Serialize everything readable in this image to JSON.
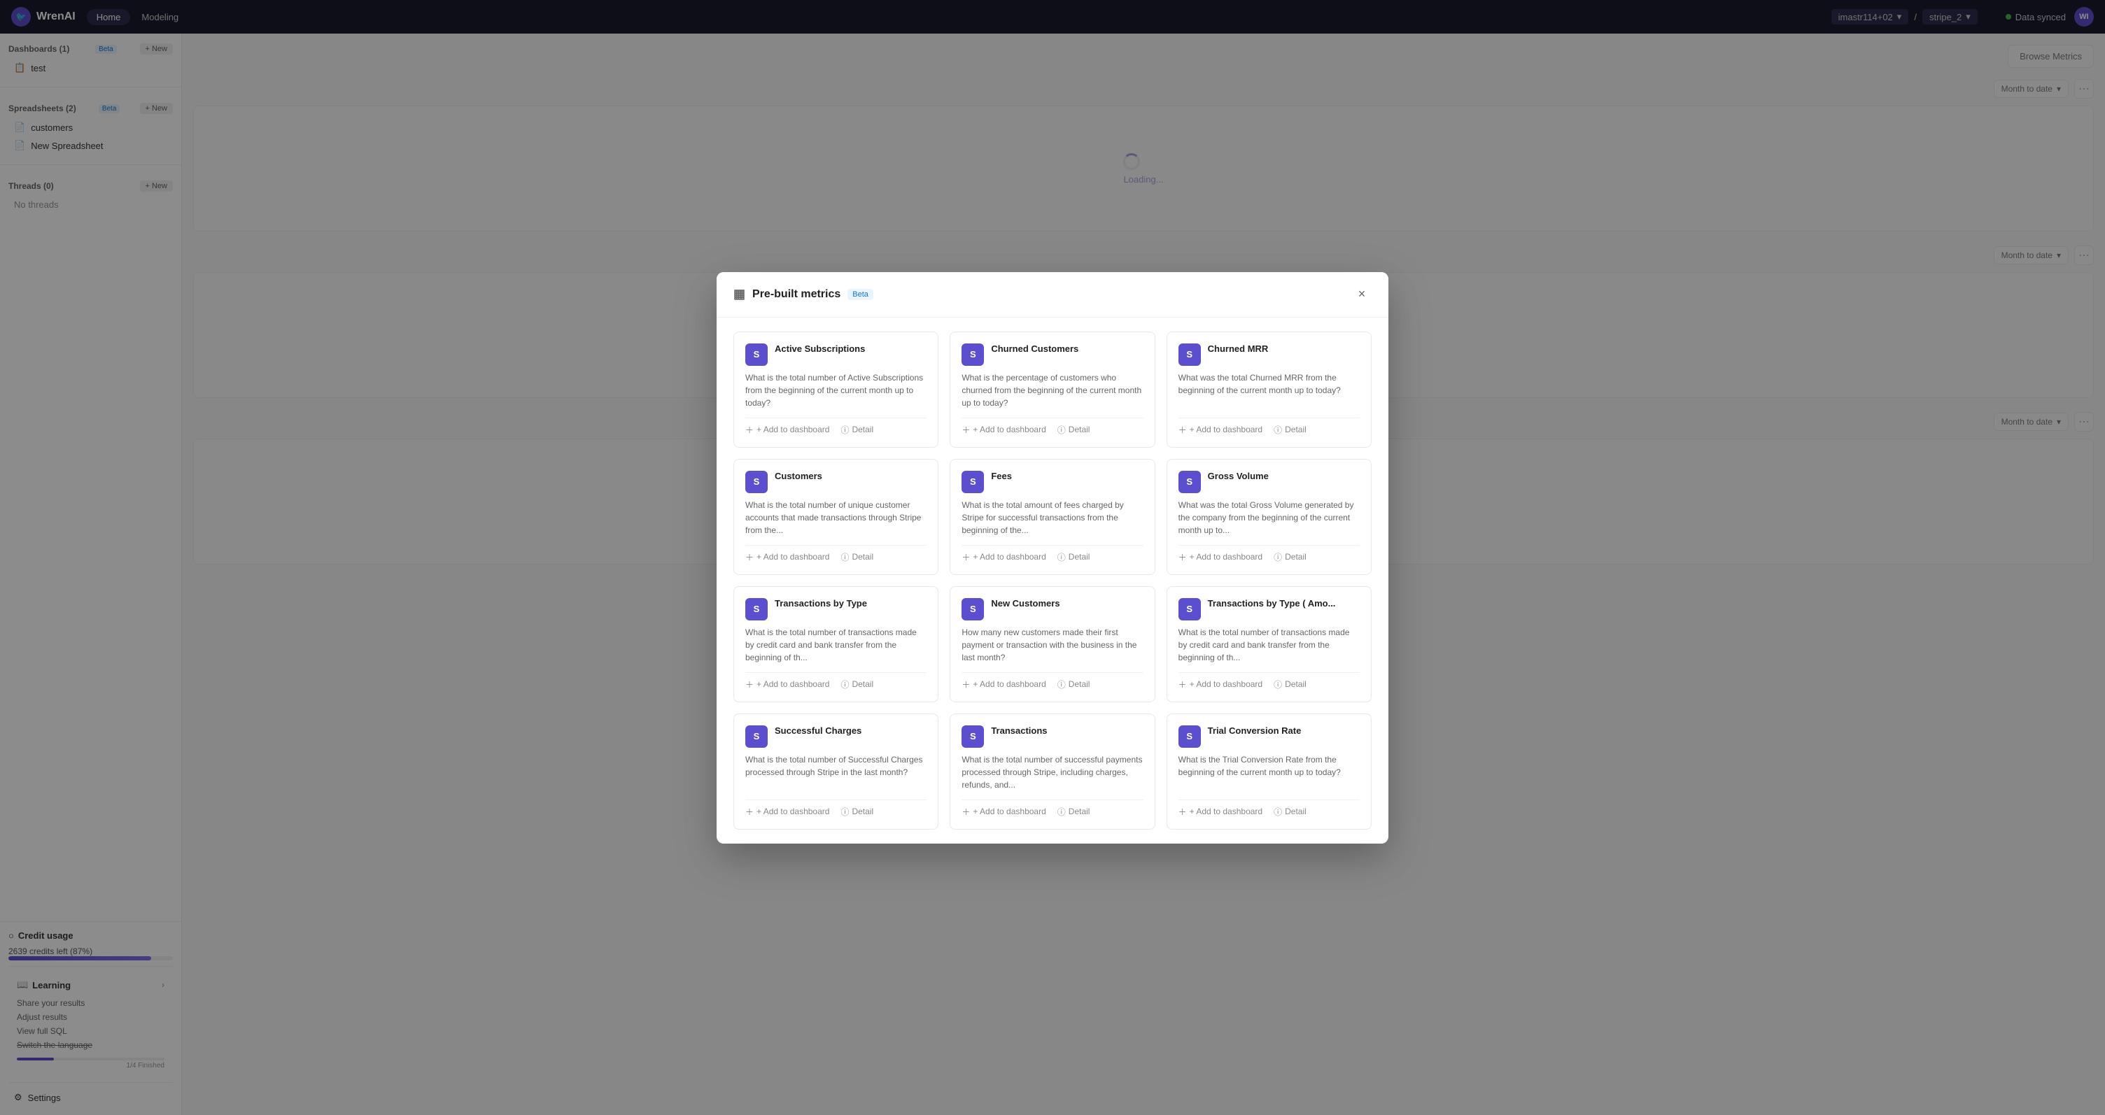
{
  "app": {
    "name": "WrenAI",
    "logo_text": "W"
  },
  "topnav": {
    "home_label": "Home",
    "modeling_label": "Modeling",
    "project": "imastr114+02",
    "project_chevron": "▾",
    "separator": "/",
    "database": "stripe_2",
    "database_chevron": "▾",
    "sync_label": "Data synced",
    "avatar_initials": "WI"
  },
  "sidebar": {
    "dashboards_label": "Dashboards (1)",
    "dashboards_beta": "Beta",
    "dashboards_new": "+ New",
    "dashboard_items": [
      {
        "name": "test",
        "icon": "📋"
      }
    ],
    "spreadsheets_label": "Spreadsheets (2)",
    "spreadsheets_beta": "Beta",
    "spreadsheets_new": "+ New",
    "spreadsheet_items": [
      {
        "name": "customers"
      },
      {
        "name": "New Spreadsheet"
      }
    ],
    "threads_label": "Threads (0)",
    "threads_new": "+ New",
    "threads_empty": "No threads",
    "credit_usage_label": "Credit usage",
    "credit_icon": "○",
    "credit_value": "2639 credits left (87%)",
    "credit_percent": 87,
    "learning_label": "Learning",
    "learning_icon": "📖",
    "learning_items": [
      {
        "label": "Share your results"
      },
      {
        "label": "Adjust results"
      },
      {
        "label": "View full SQL"
      },
      {
        "label": "Switch the language"
      }
    ],
    "progress_label": "1/4 Finished",
    "settings_label": "Settings"
  },
  "main": {
    "browse_btn": "Browse Metrics",
    "sections": [
      {
        "id": "section1",
        "date_filter": "Month to date"
      },
      {
        "id": "section2",
        "date_filter": "Month to date"
      },
      {
        "id": "section3",
        "date_filter": "Month to date"
      }
    ]
  },
  "modal": {
    "title": "Pre-built metrics",
    "beta": "Beta",
    "close_label": "×",
    "metrics": [
      {
        "id": "active-subscriptions",
        "icon": "S",
        "name": "Active Subscriptions",
        "desc": "What is the total number of Active Subscriptions from the beginning of the current month up to today?",
        "add_label": "+ Add to dashboard",
        "detail_label": "Detail"
      },
      {
        "id": "churned-customers",
        "icon": "S",
        "name": "Churned Customers",
        "desc": "What is the percentage of customers who churned from the beginning of the current month up to today?",
        "add_label": "+ Add to dashboard",
        "detail_label": "Detail"
      },
      {
        "id": "churned-mrr",
        "icon": "S",
        "name": "Churned MRR",
        "desc": "What was the total Churned MRR from the beginning of the current month up to today?",
        "add_label": "+ Add to dashboard",
        "detail_label": "Detail"
      },
      {
        "id": "customers",
        "icon": "S",
        "name": "Customers",
        "desc": "What is the total number of unique customer accounts that made transactions through Stripe from the...",
        "add_label": "+ Add to dashboard",
        "detail_label": "Detail"
      },
      {
        "id": "fees",
        "icon": "S",
        "name": "Fees",
        "desc": "What is the total amount of fees charged by Stripe for successful transactions from the beginning of the...",
        "add_label": "+ Add to dashboard",
        "detail_label": "Detail"
      },
      {
        "id": "gross-volume",
        "icon": "S",
        "name": "Gross Volume",
        "desc": "What was the total Gross Volume generated by the company from the beginning of the current month up to...",
        "add_label": "+ Add to dashboard",
        "detail_label": "Detail"
      },
      {
        "id": "transactions-by-type",
        "icon": "S",
        "name": "Transactions by Type",
        "desc": "What is the total number of transactions made by credit card and bank transfer from the beginning of th...",
        "add_label": "+ Add to dashboard",
        "detail_label": "Detail"
      },
      {
        "id": "new-customers",
        "icon": "S",
        "name": "New Customers",
        "desc": "How many new customers made their first payment or transaction with the business in the last month?",
        "add_label": "+ Add to dashboard",
        "detail_label": "Detail"
      },
      {
        "id": "transactions-by-type-amount",
        "icon": "S",
        "name": "Transactions by Type ( Amo...",
        "desc": "What is the total number of transactions made by credit card and bank transfer from the beginning of th...",
        "add_label": "+ Add to dashboard",
        "detail_label": "Detail"
      },
      {
        "id": "successful-charges",
        "icon": "S",
        "name": "Successful Charges",
        "desc": "What is the total number of Successful Charges processed through Stripe in the last month?",
        "add_label": "+ Add to dashboard",
        "detail_label": "Detail"
      },
      {
        "id": "transactions",
        "icon": "S",
        "name": "Transactions",
        "desc": "What is the total number of successful payments processed through Stripe, including charges, refunds, and...",
        "add_label": "+ Add to dashboard",
        "detail_label": "Detail"
      },
      {
        "id": "trial-conversion-rate",
        "icon": "S",
        "name": "Trial Conversion Rate",
        "desc": "What is the Trial Conversion Rate from the beginning of the current month up to today?",
        "add_label": "+ Add to dashboard",
        "detail_label": "Detail"
      }
    ]
  }
}
